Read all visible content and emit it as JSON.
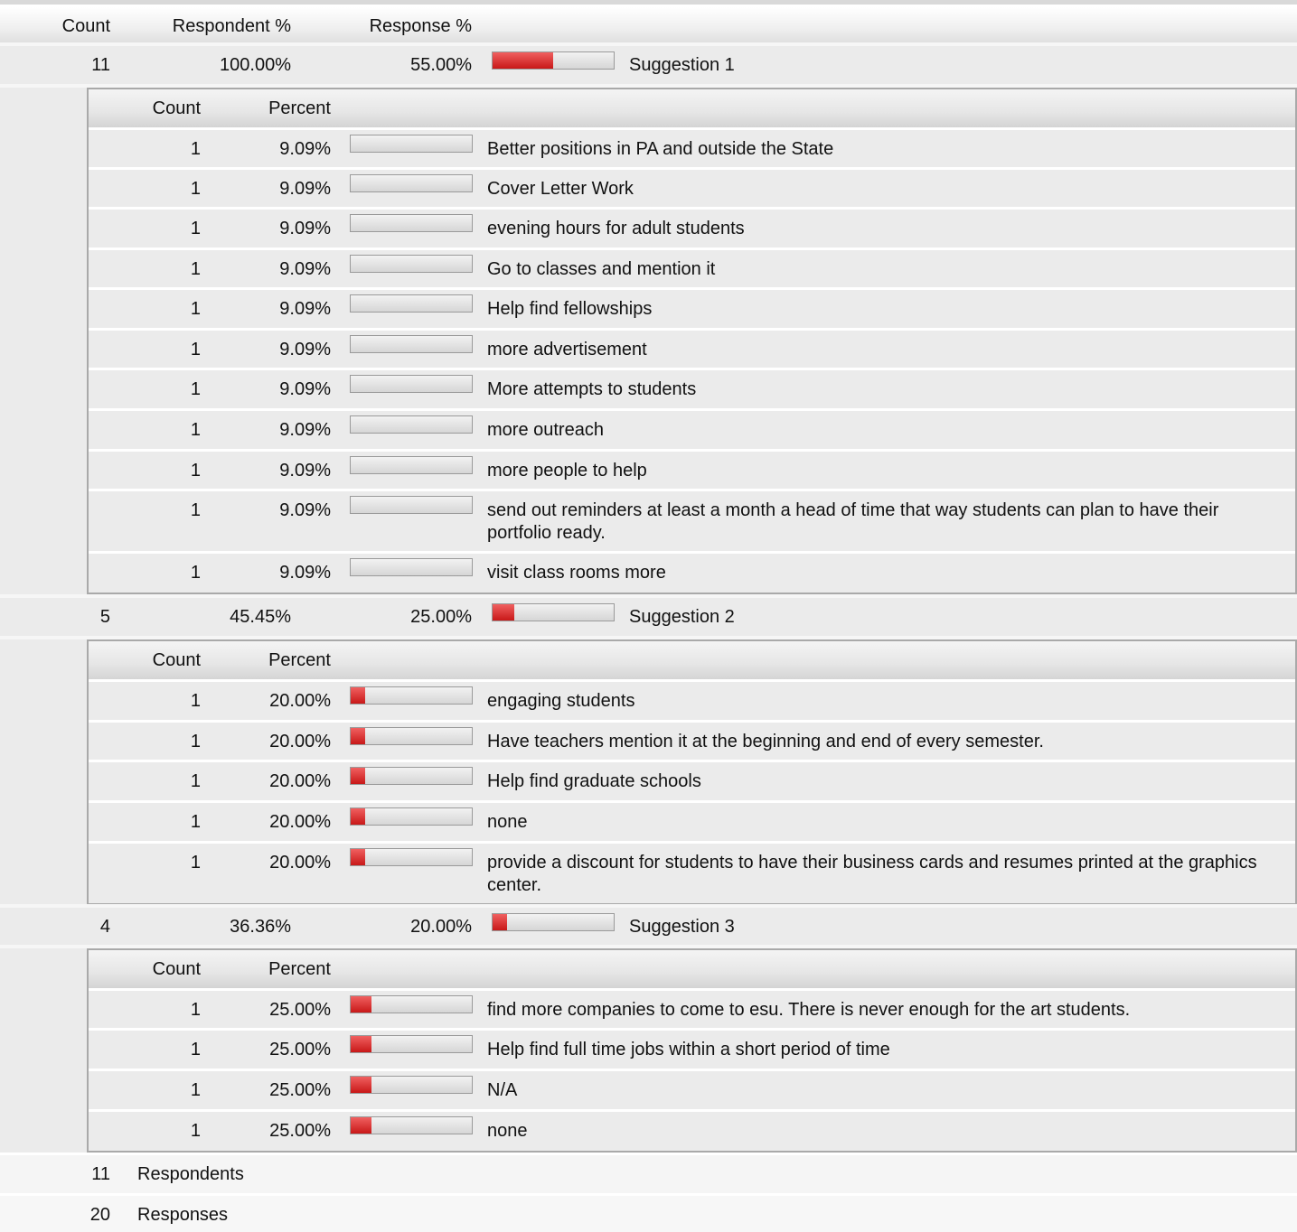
{
  "header": {
    "count": "Count",
    "respondent_pct": "Respondent %",
    "response_pct": "Response %"
  },
  "sub_header": {
    "count": "Count",
    "percent": "Percent"
  },
  "groups": [
    {
      "count": "11",
      "respondent_pct": "100.00%",
      "response_pct": "55.00%",
      "bar_fraction": 0.5,
      "label": "Suggestion 1",
      "answers": [
        {
          "count": "1",
          "percent": "9.09%",
          "bar_fraction": 0,
          "text": "Better positions in PA and outside the State"
        },
        {
          "count": "1",
          "percent": "9.09%",
          "bar_fraction": 0,
          "text": "Cover Letter Work"
        },
        {
          "count": "1",
          "percent": "9.09%",
          "bar_fraction": 0,
          "text": "evening hours for adult students"
        },
        {
          "count": "1",
          "percent": "9.09%",
          "bar_fraction": 0,
          "text": "Go to classes and mention it"
        },
        {
          "count": "1",
          "percent": "9.09%",
          "bar_fraction": 0,
          "text": "Help find fellowships"
        },
        {
          "count": "1",
          "percent": "9.09%",
          "bar_fraction": 0,
          "text": "more advertisement"
        },
        {
          "count": "1",
          "percent": "9.09%",
          "bar_fraction": 0,
          "text": "More attempts to students"
        },
        {
          "count": "1",
          "percent": "9.09%",
          "bar_fraction": 0,
          "text": "more outreach"
        },
        {
          "count": "1",
          "percent": "9.09%",
          "bar_fraction": 0,
          "text": "more people to help"
        },
        {
          "count": "1",
          "percent": "9.09%",
          "bar_fraction": 0,
          "text": "send out reminders at least a month a head of time that way students can plan to have their portfolio ready."
        },
        {
          "count": "1",
          "percent": "9.09%",
          "bar_fraction": 0,
          "text": "visit class rooms more"
        }
      ]
    },
    {
      "count": "5",
      "respondent_pct": "45.45%",
      "response_pct": "25.00%",
      "bar_fraction": 0.18,
      "label": "Suggestion 2",
      "answers": [
        {
          "count": "1",
          "percent": "20.00%",
          "bar_fraction": 0.12,
          "text": "engaging students"
        },
        {
          "count": "1",
          "percent": "20.00%",
          "bar_fraction": 0.12,
          "text": "Have teachers mention it at the beginning and end of every semester."
        },
        {
          "count": "1",
          "percent": "20.00%",
          "bar_fraction": 0.12,
          "text": "Help find graduate schools"
        },
        {
          "count": "1",
          "percent": "20.00%",
          "bar_fraction": 0.12,
          "text": "none"
        },
        {
          "count": "1",
          "percent": "20.00%",
          "bar_fraction": 0.12,
          "text": "provide a discount for students to have their business cards and resumes printed at the graphics center."
        }
      ]
    },
    {
      "count": "4",
      "respondent_pct": "36.36%",
      "response_pct": "20.00%",
      "bar_fraction": 0.12,
      "label": "Suggestion 3",
      "answers": [
        {
          "count": "1",
          "percent": "25.00%",
          "bar_fraction": 0.17,
          "text": "find more companies to come to esu. There is never enough for the art students."
        },
        {
          "count": "1",
          "percent": "25.00%",
          "bar_fraction": 0.17,
          "text": "Help find full time jobs within a short period of time"
        },
        {
          "count": "1",
          "percent": "25.00%",
          "bar_fraction": 0.17,
          "text": "N/A"
        },
        {
          "count": "1",
          "percent": "25.00%",
          "bar_fraction": 0.17,
          "text": "none"
        }
      ]
    }
  ],
  "footer": [
    {
      "value": "11",
      "label": "Respondents"
    },
    {
      "value": "20",
      "label": "Responses"
    }
  ]
}
